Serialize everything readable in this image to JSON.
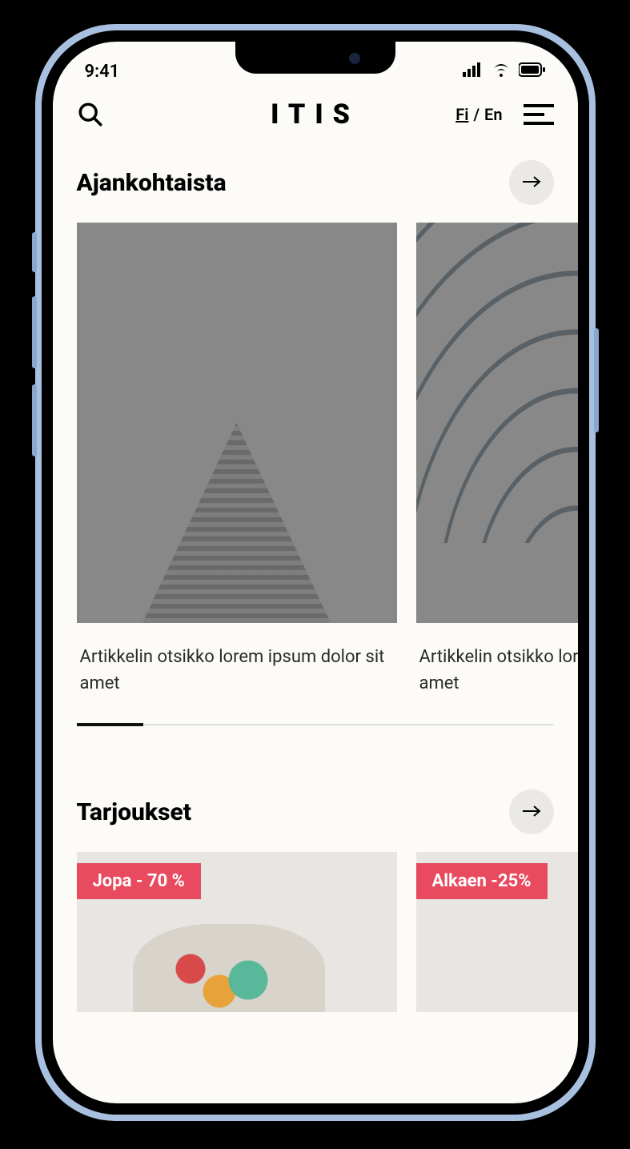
{
  "status": {
    "time": "9:41"
  },
  "header": {
    "logo": "ITIS",
    "lang_fi": "Fi",
    "lang_sep": "/",
    "lang_en": "En"
  },
  "sections": {
    "news": {
      "heading": "Ajankohtaista",
      "items": [
        {
          "title": "Artikkelin otsikko lorem ipsum dolor sit amet"
        },
        {
          "title": "Artikkelin otsikko lorem ipsum dolor sit amet"
        }
      ]
    },
    "offers": {
      "heading": "Tarjoukset",
      "items": [
        {
          "badge": "Jopa - 70 %"
        },
        {
          "badge": "Alkaen -25%"
        }
      ]
    }
  }
}
